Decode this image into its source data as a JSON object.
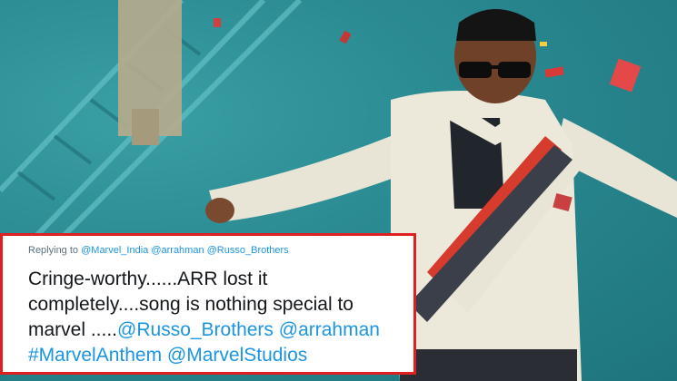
{
  "tweet": {
    "reply_prefix": "Replying to",
    "reply_mentions": [
      "@Marvel_India",
      "@arrahman",
      "@Russo_Brothers"
    ],
    "lines": [
      "Cringe-worthy......ARR lost it",
      "completely....song is nothing  special to",
      "marvel ....."
    ],
    "inline_mentions": [
      "@Russo_Brothers",
      "@arrahman"
    ],
    "hashtags_line": [
      "#MarvelAnthem",
      "@MarvelStudios"
    ]
  },
  "colors": {
    "wall": "#2b8b93",
    "card_border": "#e02020",
    "link": "#1b95e0"
  }
}
